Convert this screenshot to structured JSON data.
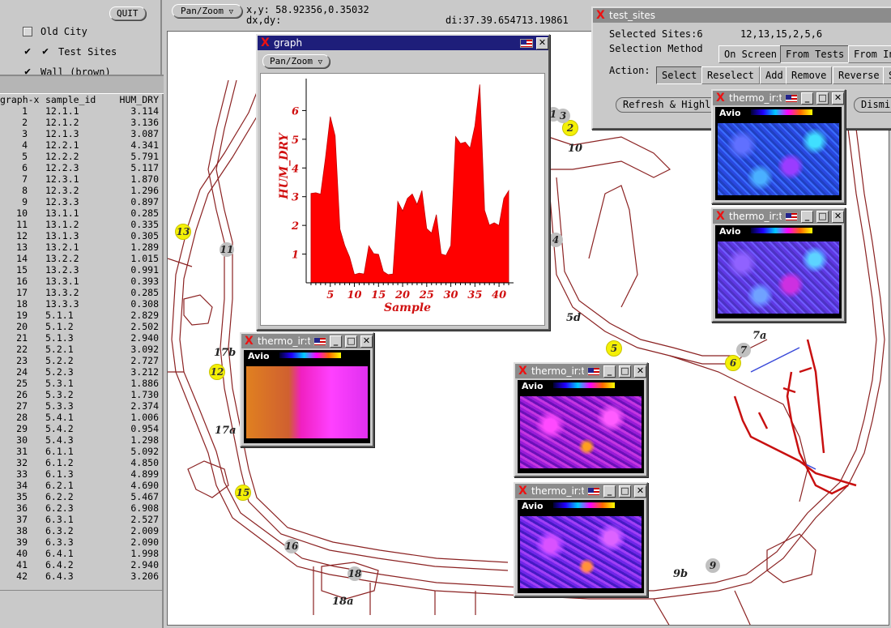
{
  "left_panel": {
    "quit_label": "QUIT",
    "layers": [
      {
        "label": "Old City",
        "checked": false
      },
      {
        "label": "Test Sites",
        "checked": true
      },
      {
        "label": "Wall (brown)",
        "checked": true
      }
    ],
    "table": {
      "headers": [
        "graph-x",
        "sample_id",
        "HUM_DRY"
      ],
      "rows": [
        [
          "1",
          "12.1.1",
          "3.114"
        ],
        [
          "2",
          "12.1.2",
          "3.136"
        ],
        [
          "3",
          "12.1.3",
          "3.087"
        ],
        [
          "4",
          "12.2.1",
          "4.341"
        ],
        [
          "5",
          "12.2.2",
          "5.791"
        ],
        [
          "6",
          "12.2.3",
          "5.117"
        ],
        [
          "7",
          "12.3.1",
          "1.870"
        ],
        [
          "8",
          "12.3.2",
          "1.296"
        ],
        [
          "9",
          "12.3.3",
          "0.897"
        ],
        [
          "10",
          "13.1.1",
          "0.285"
        ],
        [
          "11",
          "13.1.2",
          "0.335"
        ],
        [
          "12",
          "13.1.3",
          "0.305"
        ],
        [
          "13",
          "13.2.1",
          "1.289"
        ],
        [
          "14",
          "13.2.2",
          "1.015"
        ],
        [
          "15",
          "13.2.3",
          "0.991"
        ],
        [
          "16",
          "13.3.1",
          "0.393"
        ],
        [
          "17",
          "13.3.2",
          "0.285"
        ],
        [
          "18",
          "13.3.3",
          "0.308"
        ],
        [
          "19",
          "5.1.1",
          "2.829"
        ],
        [
          "20",
          "5.1.2",
          "2.502"
        ],
        [
          "21",
          "5.1.3",
          "2.940"
        ],
        [
          "22",
          "5.2.1",
          "3.092"
        ],
        [
          "23",
          "5.2.2",
          "2.727"
        ],
        [
          "24",
          "5.2.3",
          "3.212"
        ],
        [
          "25",
          "5.3.1",
          "1.886"
        ],
        [
          "26",
          "5.3.2",
          "1.730"
        ],
        [
          "27",
          "5.3.3",
          "2.374"
        ],
        [
          "28",
          "5.4.1",
          "1.006"
        ],
        [
          "29",
          "5.4.2",
          "0.954"
        ],
        [
          "30",
          "5.4.3",
          "1.298"
        ],
        [
          "31",
          "6.1.1",
          "5.092"
        ],
        [
          "32",
          "6.1.2",
          "4.850"
        ],
        [
          "33",
          "6.1.3",
          "4.899"
        ],
        [
          "34",
          "6.2.1",
          "4.690"
        ],
        [
          "35",
          "6.2.2",
          "5.467"
        ],
        [
          "36",
          "6.2.3",
          "6.908"
        ],
        [
          "37",
          "6.3.1",
          "2.527"
        ],
        [
          "38",
          "6.3.2",
          "2.009"
        ],
        [
          "39",
          "6.3.3",
          "2.090"
        ],
        [
          "40",
          "6.4.1",
          "1.998"
        ],
        [
          "41",
          "6.4.2",
          "2.940"
        ],
        [
          "42",
          "6.4.3",
          "3.206"
        ]
      ]
    }
  },
  "toolbar": {
    "pan_zoom_label": "Pan/Zoom",
    "xy_label": "x,y:",
    "xy_value": "58.92356,0.35032",
    "dxdy_label": "dx,dy:",
    "di_label": "di:",
    "di_value": "37.39.654713.19861"
  },
  "graph_window": {
    "title": "graph",
    "pan_zoom_label": "Pan/Zoom"
  },
  "chart_data": {
    "type": "area",
    "title": "",
    "xlabel": "Sample",
    "ylabel": "HUM_DRY",
    "xlim": [
      0,
      42
    ],
    "ylim": [
      0,
      7
    ],
    "xticks": [
      5,
      10,
      15,
      20,
      25,
      30,
      35,
      40
    ],
    "yticks": [
      1,
      2,
      3,
      4,
      5,
      6
    ],
    "color": "#ff0000",
    "x": [
      1,
      2,
      3,
      4,
      5,
      6,
      7,
      8,
      9,
      10,
      11,
      12,
      13,
      14,
      15,
      16,
      17,
      18,
      19,
      20,
      21,
      22,
      23,
      24,
      25,
      26,
      27,
      28,
      29,
      30,
      31,
      32,
      33,
      34,
      35,
      36,
      37,
      38,
      39,
      40,
      41,
      42
    ],
    "values": [
      3.114,
      3.136,
      3.087,
      4.341,
      5.791,
      5.117,
      1.87,
      1.296,
      0.897,
      0.285,
      0.335,
      0.305,
      1.289,
      1.015,
      0.991,
      0.393,
      0.285,
      0.308,
      2.829,
      2.502,
      2.94,
      3.092,
      2.727,
      3.212,
      1.886,
      1.73,
      2.374,
      1.006,
      0.954,
      1.298,
      5.092,
      4.85,
      4.899,
      4.69,
      5.467,
      6.908,
      2.527,
      2.009,
      2.09,
      1.998,
      2.94,
      3.206
    ]
  },
  "test_sites_window": {
    "title": "test_sites",
    "selected_label": "Selected Sites:6",
    "selected_value": "12,13,15,2,5,6",
    "method_label": "Selection Method",
    "method_buttons": [
      "On Screen",
      "From Tests",
      "From In"
    ],
    "action_label": "Action:",
    "action_buttons": [
      "Select",
      "Reselect",
      "Add",
      "Remove",
      "Reverse",
      "S"
    ],
    "refresh_label": "Refresh & Highl",
    "dismiss_label": "Dismis"
  },
  "thermo_windows": [
    {
      "title": "thermo_ir:th"
    },
    {
      "title": "thermo_ir:th"
    },
    {
      "title": "thermo_ir:th"
    },
    {
      "title": "thermo_ir:th"
    },
    {
      "title": "thermo_ir:th"
    }
  ],
  "thermo_image": {
    "brand": "Avio"
  },
  "map_sites": {
    "yellow": [
      "13",
      "12",
      "15",
      "2",
      "5",
      "6"
    ],
    "grey": [
      "11",
      "17b",
      "17a",
      "16",
      "18",
      "18a",
      "3",
      "10",
      "4",
      "5d",
      "7a",
      "7",
      "9b",
      "9",
      "1"
    ]
  }
}
